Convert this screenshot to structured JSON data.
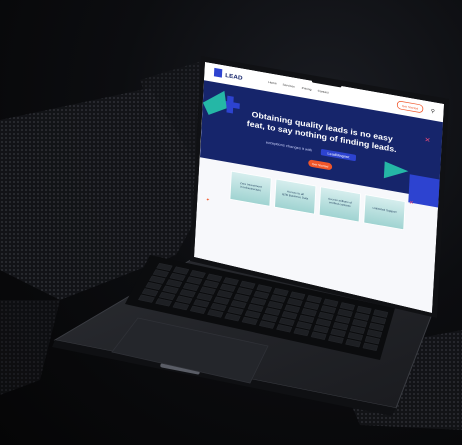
{
  "site": {
    "logo_text": "LEAD",
    "nav": [
      "Home",
      "Services",
      "Pricing",
      "Contact"
    ],
    "get_started": "Get Started",
    "hero": {
      "line1": "Obtaining quality leads is no easy",
      "line2": "feat, to say nothing of finding leads.",
      "tagline": "exceptions changes it with",
      "brand_pill": "LeadMagnet",
      "cta": "Get Started"
    },
    "cards": [
      {
        "title": "Zero Investment",
        "sub": "in Infrastructure"
      },
      {
        "title": "Access to all",
        "sub": "B2B Business Data"
      },
      {
        "title": "Access millions of",
        "sub": "verified contacts"
      },
      {
        "title": "Unlimited Support",
        "sub": ""
      }
    ]
  },
  "colors": {
    "hero_navy": "#16256b",
    "accent_teal": "#25b7a6",
    "accent_orange": "#f0562a",
    "accent_pink": "#e2497a",
    "accent_blue": "#2d43d0",
    "card_teal": "#bfe3e2"
  }
}
